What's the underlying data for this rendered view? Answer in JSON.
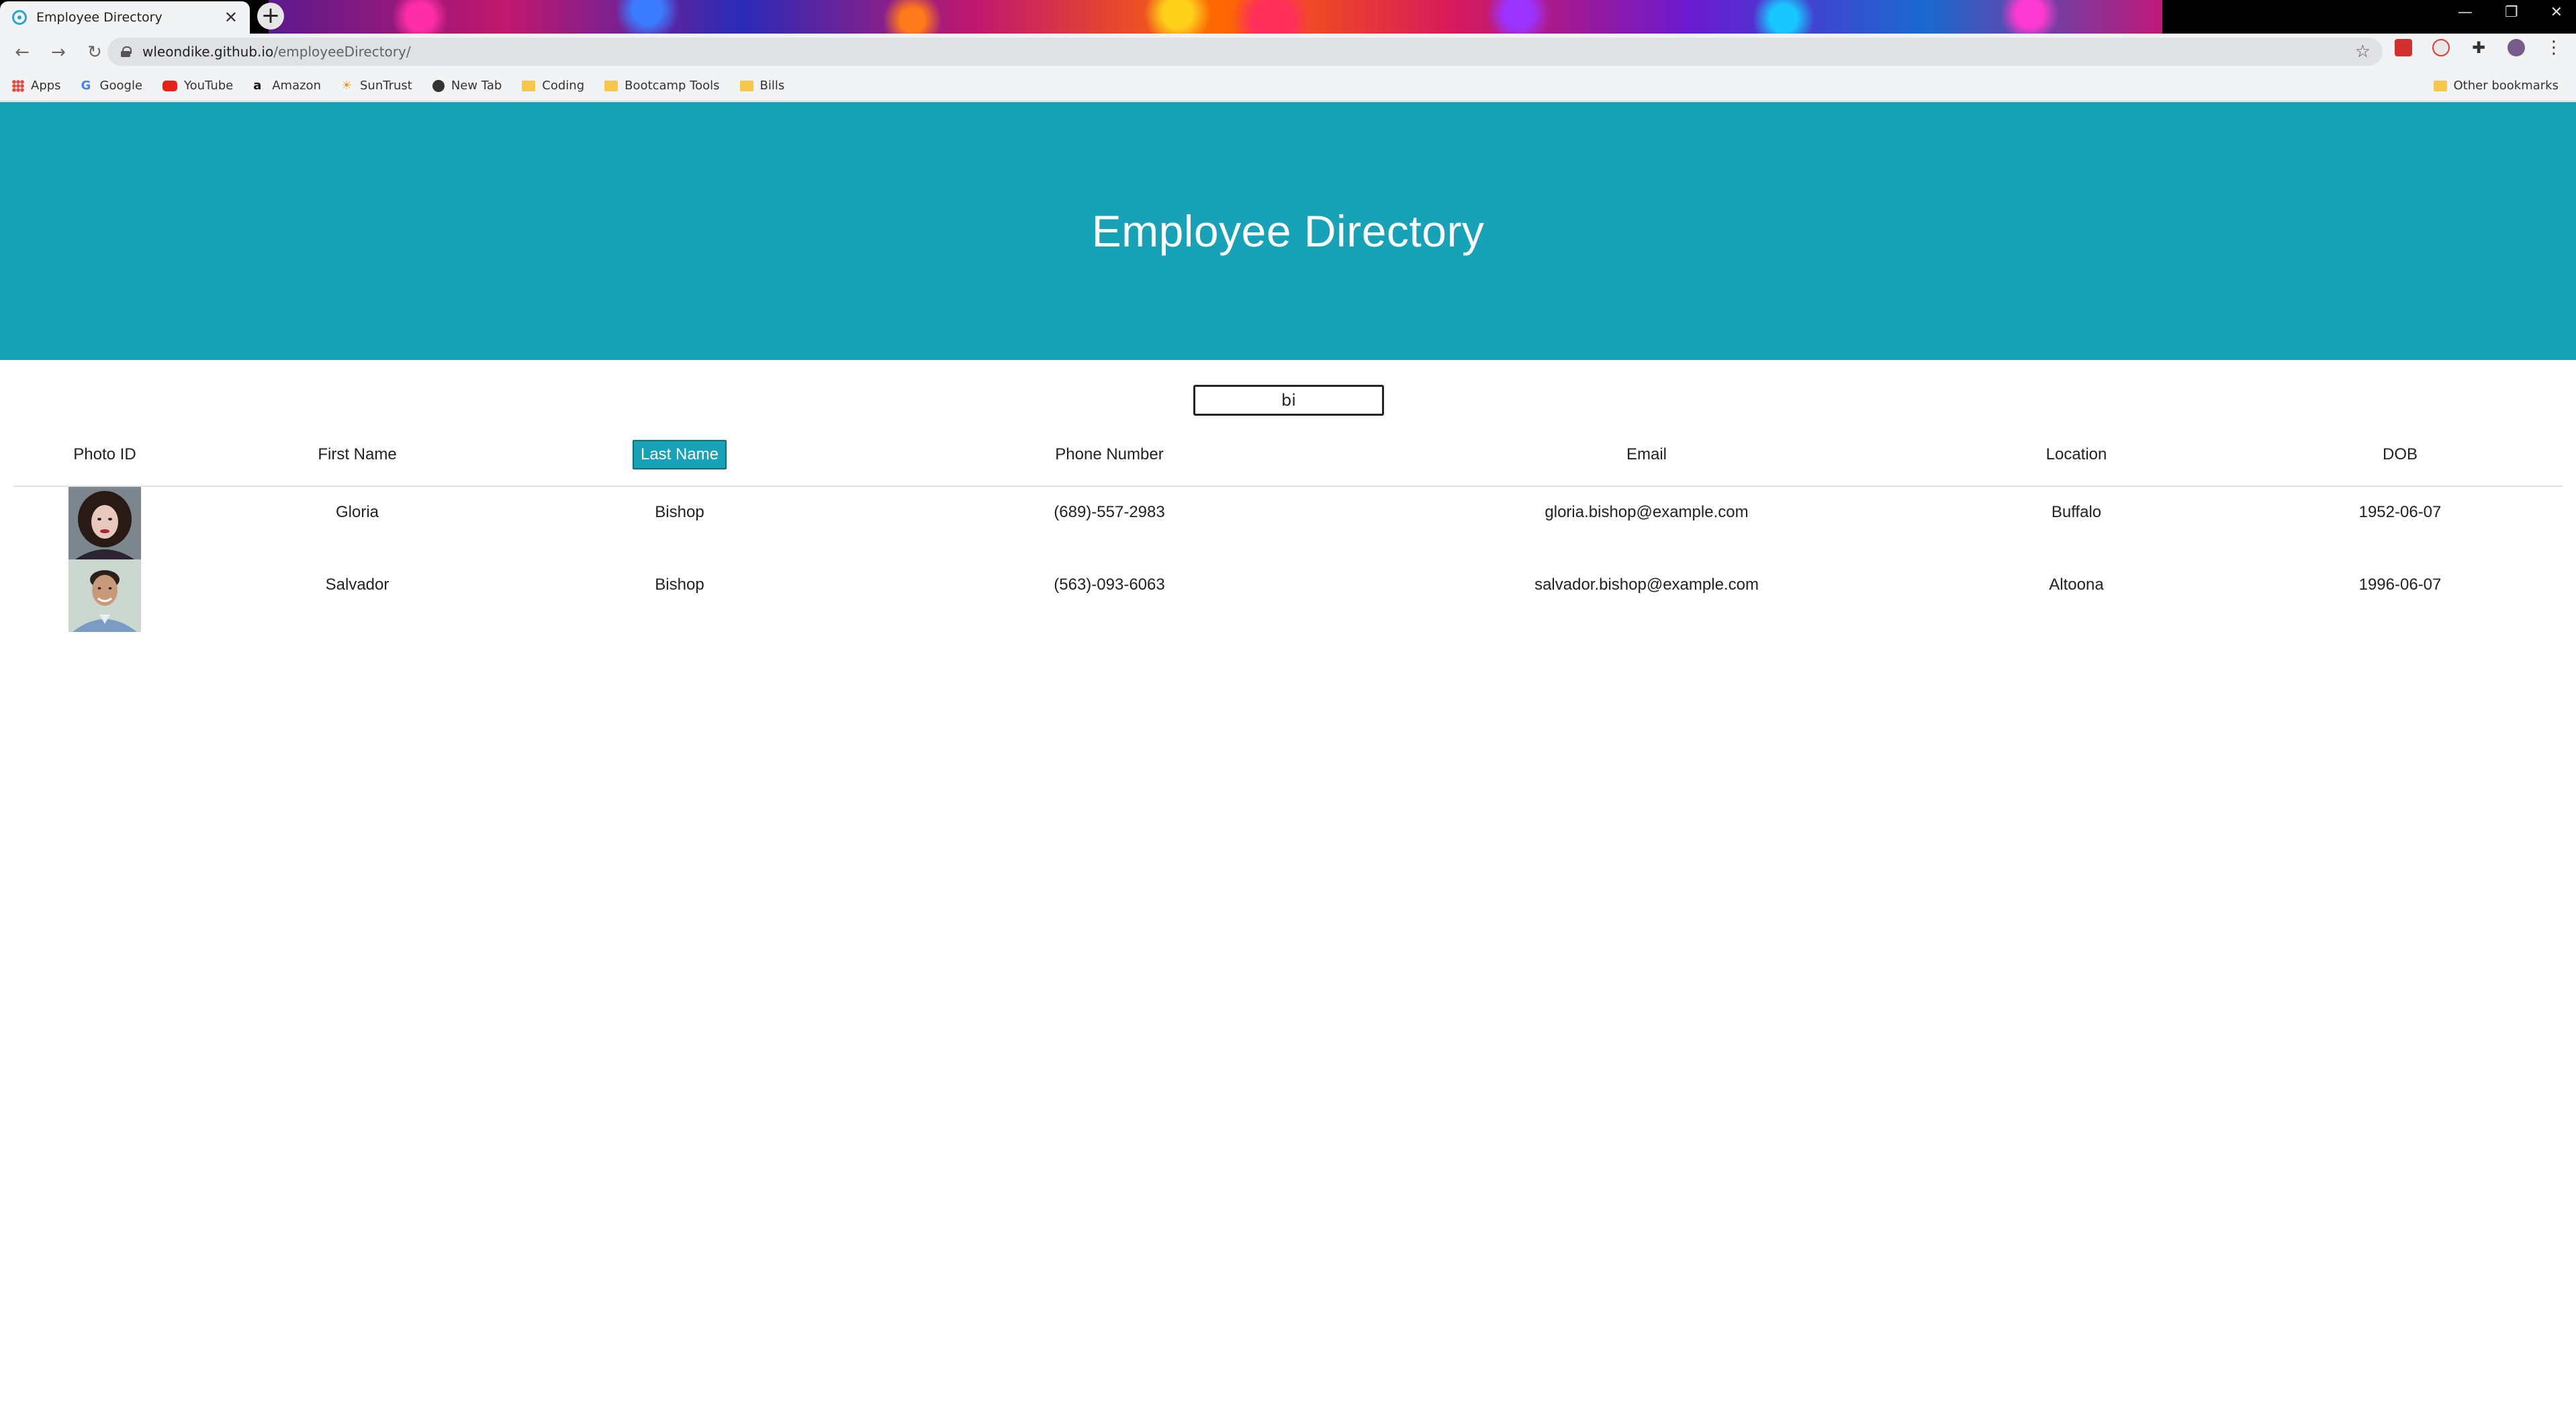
{
  "browser": {
    "tab_title": "Employee Directory",
    "new_tab": "+",
    "url_host": "wleondike.github.io",
    "url_path": "/employeeDirectory/",
    "bookmarks": [
      {
        "label": "Apps",
        "icon": "apps-icon"
      },
      {
        "label": "Google",
        "icon": "google-icon"
      },
      {
        "label": "YouTube",
        "icon": "youtube-icon"
      },
      {
        "label": "Amazon",
        "icon": "amazon-icon"
      },
      {
        "label": "SunTrust",
        "icon": "suntrust-icon"
      },
      {
        "label": "New Tab",
        "icon": "globe-icon"
      },
      {
        "label": "Coding",
        "icon": "folder-icon"
      },
      {
        "label": "Bootcamp Tools",
        "icon": "folder-icon"
      },
      {
        "label": "Bills",
        "icon": "folder-icon"
      }
    ],
    "other_bookmarks": "Other bookmarks"
  },
  "page": {
    "title": "Employee Directory",
    "search_value": "bi",
    "accent_color": "#17a2b8"
  },
  "table": {
    "headers": [
      "Photo ID",
      "First Name",
      "Last Name",
      "Phone Number",
      "Email",
      "Location",
      "DOB"
    ],
    "sorted_column": "Last Name",
    "rows": [
      {
        "first": "Gloria",
        "last": "Bishop",
        "phone": "(689)-557-2983",
        "email": "gloria.bishop@example.com",
        "location": "Buffalo",
        "dob": "1952-06-07"
      },
      {
        "first": "Salvador",
        "last": "Bishop",
        "phone": "(563)-093-6063",
        "email": "salvador.bishop@example.com",
        "location": "Altoona",
        "dob": "1996-06-07"
      }
    ]
  }
}
